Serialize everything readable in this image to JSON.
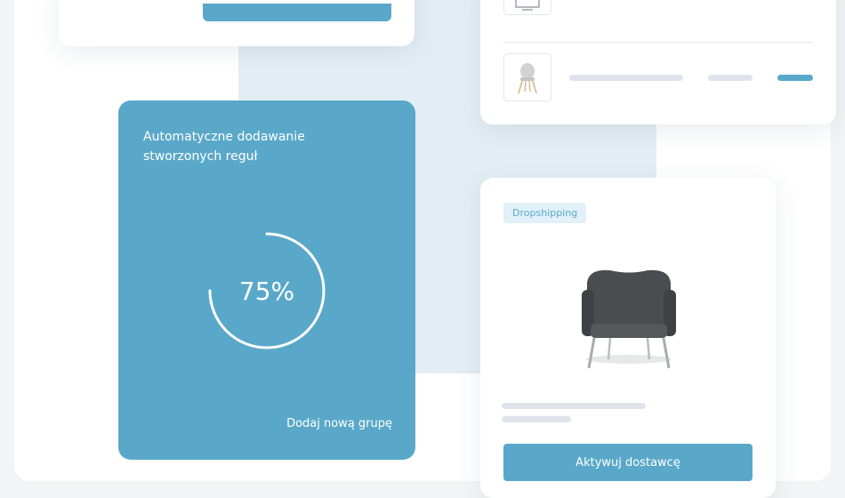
{
  "rules_card": {
    "title": "Automatyczne dodawanie stworzonych reguł",
    "progress": 75,
    "progress_label": "75%",
    "add_group_label": "Dodaj nową grupę"
  },
  "product_card": {
    "badge": "Dropshipping",
    "product_icon": "armchair-icon",
    "activate_button": "Aktywuj dostawcę"
  },
  "product_list": {
    "row_icons": [
      "monitor-icon",
      "chair-icon"
    ]
  },
  "colors": {
    "accent": "#5aa8c9",
    "badge_bg": "#e1f0f9",
    "placeholder_bar": "#dfe4ec",
    "tint": "#e3eef4"
  }
}
